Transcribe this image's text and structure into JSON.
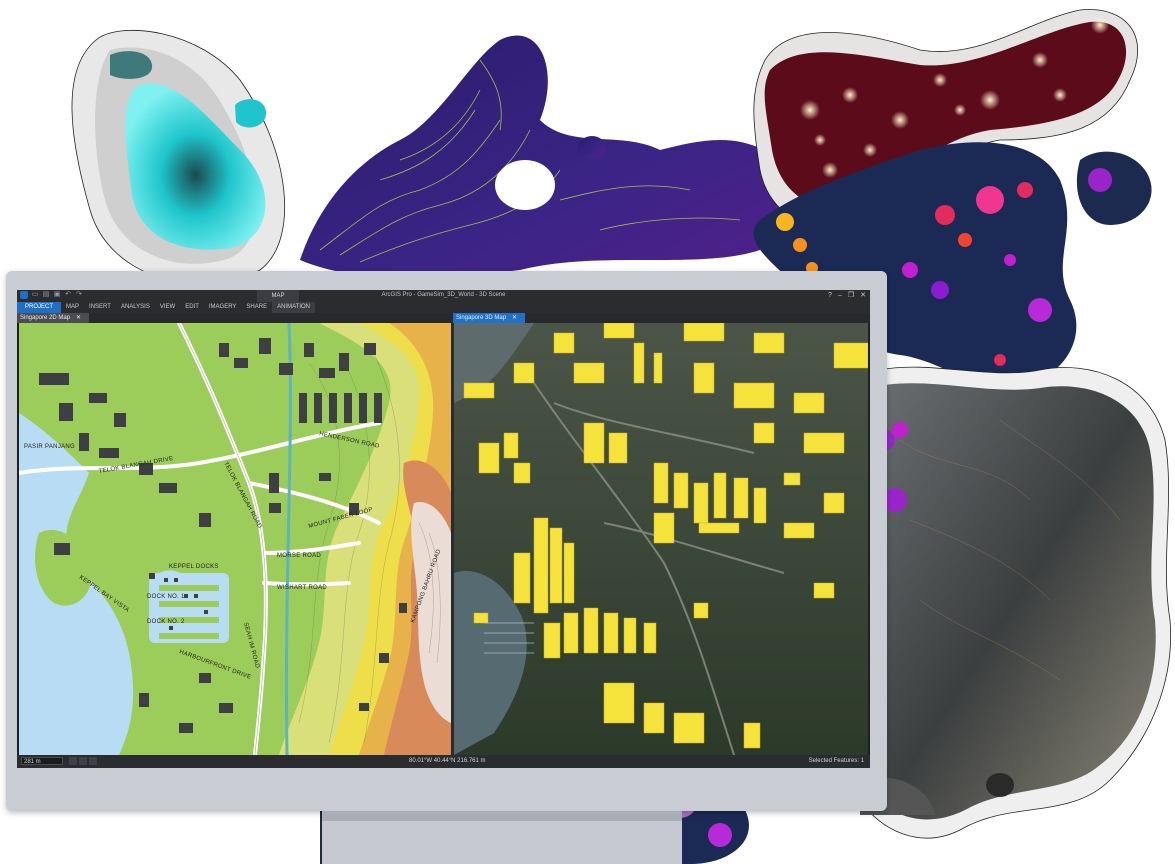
{
  "app": {
    "window_title": "ArcGIS Pro - GameSim_3D_World - 3D Scene",
    "contextual_tab": "MAP",
    "ribbon_tabs": [
      "PROJECT",
      "MAP",
      "INSERT",
      "ANALYSIS",
      "VIEW",
      "EDIT",
      "IMAGERY",
      "SHARE",
      "ANIMATION"
    ],
    "window_controls": [
      "?",
      "–",
      "❐",
      "✕"
    ]
  },
  "views": {
    "left_tab": "Singapore 2D Map",
    "right_tab": "Singapore 3D Map",
    "close_glyph": "✕"
  },
  "map_labels": {
    "henderson": "HENDERSON ROAD",
    "telok": "TELOK BLANGAH ROAD",
    "mount_faber": "MOUNT FABER LOOP",
    "morse": "MORSE ROAD",
    "wishart": "WISHART ROAD",
    "keppel": "KEPPEL BAY VISTA",
    "docks": "KEPPEL DOCKS",
    "dock_no1": "DOCK NO. 1",
    "dock_no2": "DOCK NO. 2",
    "harbourfront": "HARBOURFRONT DRIVE",
    "tebing": "TELOK BLANGAH DRIVE",
    "seah_im": "SEAH IM ROAD",
    "kampong": "KAMPONG BAHRU ROAD",
    "pasir": "PASIR PANJANG"
  },
  "statusbar": {
    "scale": "281 m",
    "coordinates": "80.01°W 40.44°N  216.761 m",
    "selected_features": "Selected Features: 1"
  },
  "colors": {
    "accent": "#1f6fc5",
    "building_3d": "#f5e23a",
    "water": "#b9dcf5",
    "terrain_low": "#9ccc5a",
    "terrain_mid": "#eedf4a",
    "terrain_high": "#d88a5a"
  }
}
